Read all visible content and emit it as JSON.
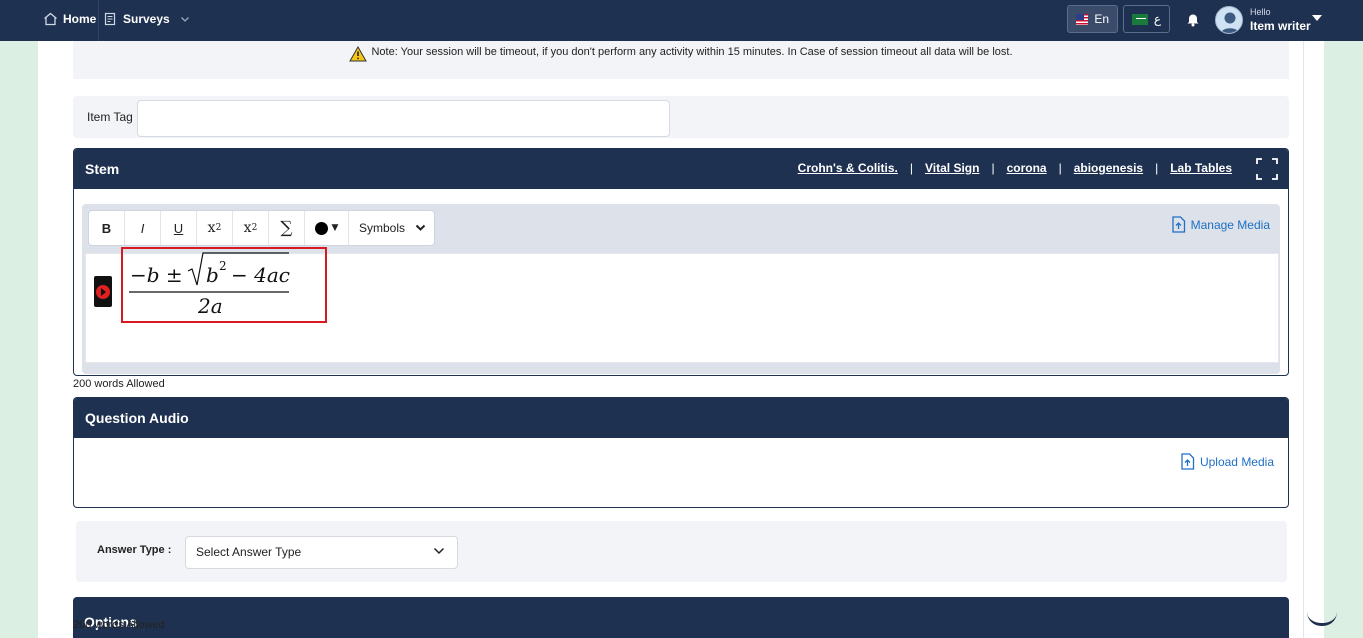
{
  "nav": {
    "home": "Home",
    "surveys": "Surveys"
  },
  "lang": {
    "en": "En",
    "ar": "ع"
  },
  "user": {
    "greeting": "Hello",
    "name": "Item writer"
  },
  "notice": {
    "text": "Note: Your session will be timeout, if you don't perform any activity within 15 minutes. In Case of session timeout all data will be lost."
  },
  "item_tag": {
    "label": "Item Tag",
    "value": ""
  },
  "stem": {
    "title": "Stem",
    "links": [
      "Crohn's & Colitis.",
      "Vital Sign",
      "corona",
      "abiogenesis",
      "Lab Tables"
    ],
    "separator": "|",
    "toolbar": {
      "bold": "B",
      "italic": "I",
      "underline": "U",
      "subscript": "x",
      "subscript_mark": "2",
      "superscript": "x",
      "superscript_mark": "2",
      "sum": "∑",
      "symbols": "Symbols"
    },
    "manage_media": "Manage Media",
    "formula": {
      "numerator_lead": "−b ±",
      "radicand_base": "b",
      "radicand_exp": "2",
      "radicand_tail": "− 4ac",
      "denominator": "2a"
    },
    "words_allowed": "200 words Allowed"
  },
  "question_audio": {
    "title": "Question Audio",
    "upload_media": "Upload Media"
  },
  "answer_type": {
    "label": "Answer Type :",
    "selected": "Select Answer Type"
  },
  "options": {
    "title": "Options",
    "words_allowed": "200 words Allowed"
  },
  "colors": {
    "navy": "#1f3150",
    "link_blue": "#1f6fc5",
    "highlight_red": "#d71920"
  }
}
